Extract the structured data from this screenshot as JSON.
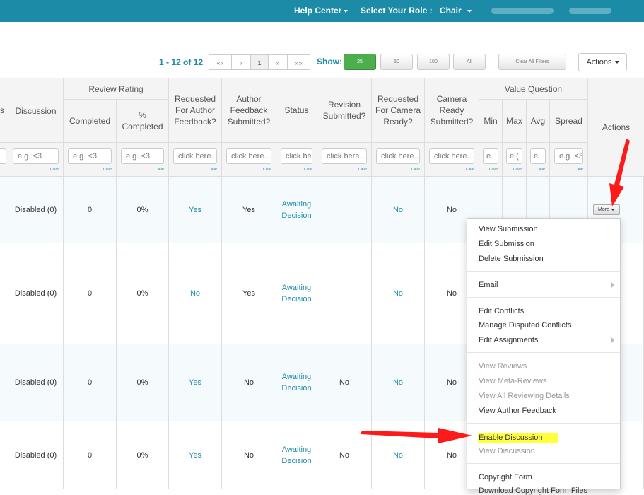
{
  "topbar": {
    "help_center": "Help Center",
    "role_label": "Select Your Role :",
    "role_value": "Chair"
  },
  "pagination": {
    "count": "1 - 12 of 12",
    "first": "««",
    "prev": "«",
    "page": "1",
    "next": "»",
    "last": "»»"
  },
  "show": {
    "label": "Show:",
    "options": [
      "25",
      "50",
      "100",
      "All"
    ],
    "selected": "25"
  },
  "clear_filters": "Clear All Filters",
  "actions": "Actions",
  "columns": {
    "partial": "s",
    "discussion": "Discussion",
    "review_rating": "Review Rating",
    "completed": "Completed",
    "pct_completed": "% Completed",
    "requested_author_feedback": "Requested For Author Feedback?",
    "author_feedback_submitted": "Author Feedback Submitted?",
    "status": "Status",
    "revision_submitted": "Revision Submitted?",
    "requested_camera_ready": "Requested For Camera Ready?",
    "camera_ready_submitted": "Camera Ready Submitted?",
    "value_question": "Value Question",
    "min": "Min",
    "max": "Max",
    "avg": "Avg",
    "spread": "Spread",
    "actions": "Actions"
  },
  "filters": {
    "clear": "Clear",
    "eg": "e.g. <3",
    "click": "click here...",
    "status_click": "click he",
    "min": "e.",
    "max": "e.(",
    "avg": "e.",
    "spread": "e.g. <3",
    "first": "e"
  },
  "rows": [
    {
      "discussion": "Disabled (0)",
      "completed": "0",
      "pct": "0%",
      "req_af": "Yes",
      "af_sub": "Yes",
      "status": "Awaiting Decision",
      "rev_sub": "",
      "req_cr": "No",
      "cr_sub": "No"
    },
    {
      "discussion": "Disabled (0)",
      "completed": "0",
      "pct": "0%",
      "req_af": "No",
      "af_sub": "Yes",
      "status": "Awaiting Decision",
      "rev_sub": "",
      "req_cr": "No",
      "cr_sub": "No"
    },
    {
      "discussion": "Disabled (0)",
      "completed": "0",
      "pct": "0%",
      "req_af": "Yes",
      "af_sub": "No",
      "status": "Awaiting Decision",
      "rev_sub": "No",
      "req_cr": "No",
      "cr_sub": "No"
    },
    {
      "discussion": "Disabled (0)",
      "completed": "0",
      "pct": "0%",
      "req_af": "Yes",
      "af_sub": "No",
      "status": "Awaiting Decision",
      "rev_sub": "No",
      "req_cr": "No",
      "cr_sub": "No"
    }
  ],
  "more_button": "More",
  "menu": {
    "view_submission": "View Submission",
    "edit_submission": "Edit Submission",
    "delete_submission": "Delete Submission",
    "email": "Email",
    "edit_conflicts": "Edit Conflicts",
    "manage_disputed": "Manage Disputed Conflicts",
    "edit_assignments": "Edit Assignments",
    "view_reviews": "View Reviews",
    "view_meta_reviews": "View Meta-Reviews",
    "view_all_reviewing": "View All Reviewing Details",
    "view_author_feedback": "View Author Feedback",
    "enable_discussion": "Enable Discussion",
    "view_discussion": "View Discussion",
    "copyright_form": "Copyright Form",
    "last_partial": "Download Copyright Form Files"
  },
  "colors": {
    "topbar": "#1b8ba7",
    "link": "#1b8ba7",
    "highlight": "#ffff3a",
    "arrow": "#ff1a1a",
    "active_show": "#4cae4c"
  }
}
